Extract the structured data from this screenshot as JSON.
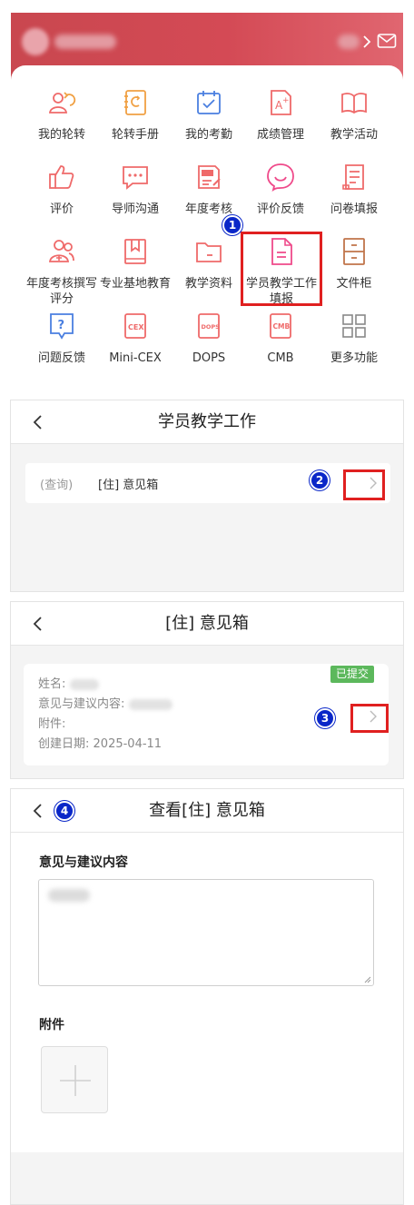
{
  "panel1": {
    "header_icons": [
      "chevron-right-icon",
      "mail-icon"
    ],
    "accent_color": "#d44a55",
    "grid": [
      {
        "label": "我的轮转",
        "icon": "rotation-icon"
      },
      {
        "label": "轮转手册",
        "icon": "handbook-icon"
      },
      {
        "label": "我的考勤",
        "icon": "attendance-icon"
      },
      {
        "label": "成绩管理",
        "icon": "grade-icon"
      },
      {
        "label": "教学活动",
        "icon": "book-open-icon"
      },
      {
        "label": "评价",
        "icon": "thumbs-up-icon"
      },
      {
        "label": "导师沟通",
        "icon": "chat-icon"
      },
      {
        "label": "年度考核",
        "icon": "annual-exam-icon"
      },
      {
        "label": "评价反馈",
        "icon": "smile-bubble-icon"
      },
      {
        "label": "问卷填报",
        "icon": "questionnaire-icon"
      },
      {
        "label": "年度考核撰写评分",
        "icon": "users-icon"
      },
      {
        "label": "专业基地教育",
        "icon": "bookmark-book-icon"
      },
      {
        "label": "教学资料",
        "icon": "folder-icon"
      },
      {
        "label": "学员教学工作填报",
        "icon": "document-icon"
      },
      {
        "label": "文件柜",
        "icon": "cabinet-icon"
      },
      {
        "label": "问题反馈",
        "icon": "question-icon"
      },
      {
        "label": "Mini-CEX",
        "icon": "cex-icon"
      },
      {
        "label": "DOPS",
        "icon": "dops-icon"
      },
      {
        "label": "CMB",
        "icon": "cmb-icon"
      },
      {
        "label": "更多功能",
        "icon": "grid-icon"
      }
    ]
  },
  "steps": [
    "1",
    "2",
    "3",
    "4"
  ],
  "panel2": {
    "title": "学员教学工作",
    "row": {
      "tag": "(查询)",
      "text": "[住] 意见箱"
    }
  },
  "panel3": {
    "title": "[住] 意见箱",
    "badge": "已提交",
    "badge_color": "#5cb85c",
    "name_label": "姓名:",
    "content_label": "意见与建议内容:",
    "attachment_label": "附件:",
    "date_label": "创建日期:",
    "date_value": "2025-04-11"
  },
  "panel4": {
    "title": "查看[住] 意见箱",
    "content_heading": "意见与建议内容",
    "attachment_heading": "附件"
  }
}
